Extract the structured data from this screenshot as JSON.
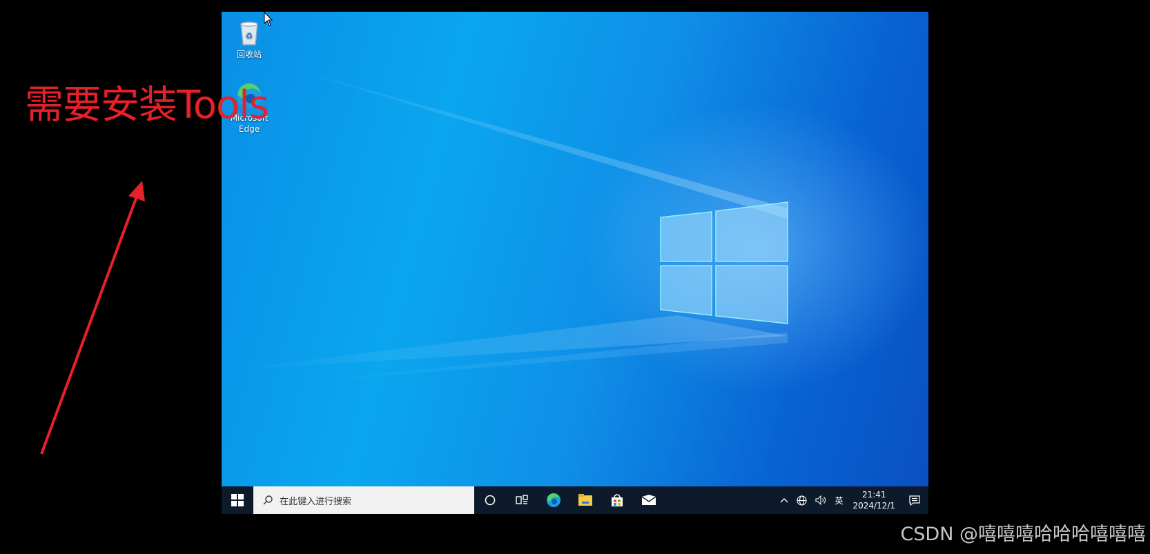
{
  "desktop": {
    "icons": [
      {
        "label": "回收站",
        "icon": "recycle-bin-icon"
      },
      {
        "label": "Microsoft Edge",
        "icon": "edge-icon"
      }
    ]
  },
  "taskbar": {
    "search_placeholder": "在此键入进行搜索",
    "pinned": [
      "cortana-icon",
      "task-view-icon",
      "edge-icon",
      "file-explorer-icon",
      "store-icon",
      "mail-icon"
    ],
    "tray": {
      "input_method": "英",
      "time": "21:41",
      "date": "2024/12/1"
    }
  },
  "annotation": {
    "text": "需要安装Tools",
    "color": "#e8202a"
  },
  "watermark": "CSDN @嘻嘻嘻哈哈哈嘻嘻嘻",
  "colors": {
    "taskbar": "#0d1a2b",
    "desktop_accent": "#0a8fe6"
  }
}
